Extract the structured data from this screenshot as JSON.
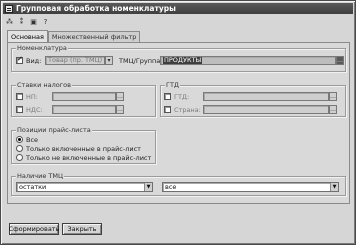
{
  "window": {
    "title": "Групповая обработка номенклатуры"
  },
  "toolbar": {
    "buttons": [
      {
        "name": "toolbar-button-1",
        "icon": "select-all-icon",
        "glyph": "⁂"
      },
      {
        "name": "toolbar-button-2",
        "icon": "deselect-icon",
        "glyph": "⁑"
      },
      {
        "name": "toolbar-button-3",
        "icon": "save-icon",
        "glyph": "▣"
      },
      {
        "name": "toolbar-button-4",
        "icon": "help-icon",
        "glyph": "?"
      }
    ]
  },
  "tabs": [
    {
      "label": "Основная",
      "active": true
    },
    {
      "label": "Множественный фильтр",
      "active": false
    }
  ],
  "nomenclature": {
    "group_label": "Номенклатура",
    "type_label": "Вид:",
    "type_value": "Товар (пр. ТМЦ)",
    "tmc_group_label": "ТМЦ/Группа:",
    "tmc_group_value": "ПРОДУКТЫ"
  },
  "tax": {
    "group_label": "Ставки налогов",
    "nds_label": "НП:",
    "nds_value": "",
    "nds2_label": "НДС:",
    "nds2_value": ""
  },
  "gtd": {
    "group_label": "ГТД",
    "gtd_label": "ГТД:",
    "gtd_value": "",
    "country_label": "Страна:",
    "country_value": ""
  },
  "price_list": {
    "group_label": "Позиции прайс-листа",
    "options": [
      "Все",
      "Только включенные в прайс-лист",
      "Только не включенные в прайс-лист"
    ],
    "selected_index": 0
  },
  "stock": {
    "group_label": "Наличие ТМЦ",
    "left_value": "остатки",
    "right_value": "все"
  },
  "footer": {
    "generate_label": "Сформировать",
    "close_label": "Закрыть"
  },
  "colors": {
    "title_bar": "#4a4a4a",
    "window_bg": "#d6d6d6",
    "selected_field": "#4b4b4b"
  }
}
